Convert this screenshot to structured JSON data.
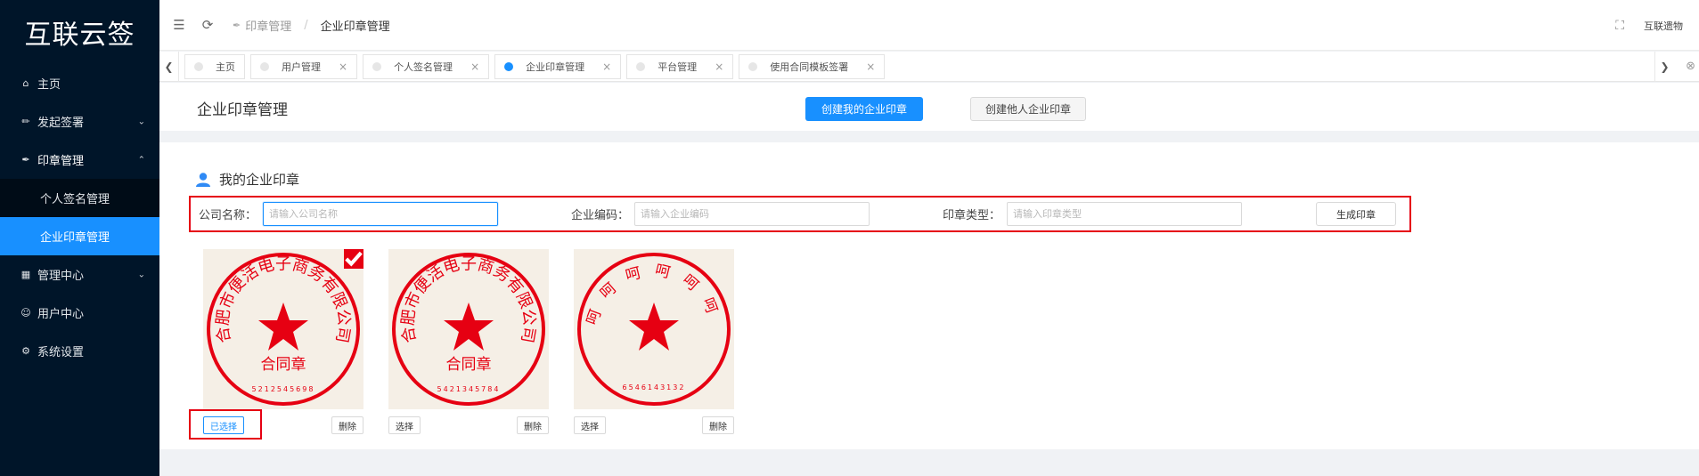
{
  "app": {
    "title": "互联云签"
  },
  "sidebar": {
    "items": [
      {
        "label": "主页",
        "icon": "home-icon"
      },
      {
        "label": "发起签署",
        "icon": "sign-icon"
      },
      {
        "label": "印章管理",
        "icon": "pen-icon"
      },
      {
        "label": "个人签名管理"
      },
      {
        "label": "企业印章管理"
      },
      {
        "label": "管理中心",
        "icon": "grid-icon"
      },
      {
        "label": "用户中心",
        "icon": "user-icon"
      },
      {
        "label": "系统设置",
        "icon": "gear-icon"
      }
    ]
  },
  "header": {
    "breadcrumb": [
      "印章管理",
      "企业印章管理"
    ],
    "separator": "/",
    "user": "互联遗物"
  },
  "tabs": [
    {
      "label": "主页"
    },
    {
      "label": "用户管理"
    },
    {
      "label": "个人签名管理"
    },
    {
      "label": "企业印章管理"
    },
    {
      "label": "平台管理"
    },
    {
      "label": "使用合同模板签署"
    }
  ],
  "page": {
    "title": "企业印章管理",
    "create_mine": "创建我的企业印章",
    "create_other": "创建他人企业印章"
  },
  "section": {
    "title": "我的企业印章"
  },
  "form": {
    "company_label": "公司名称：",
    "company_placeholder": "请输入公司名称",
    "code_label": "企业编码：",
    "code_placeholder": "请输入企业编码",
    "type_label": "印章类型：",
    "type_placeholder": "请输入印章类型",
    "generate": "生成印章"
  },
  "seals": [
    {
      "top_text": "合肥市便活电子商务有限公司",
      "bottom_text": "合同章",
      "code": "5212545698",
      "select_label": "已选择",
      "delete_label": "删除",
      "selected": true
    },
    {
      "top_text": "合肥市便活电子商务有限公司",
      "bottom_text": "合同章",
      "code": "5421345784",
      "select_label": "选择",
      "delete_label": "删除",
      "selected": false
    },
    {
      "top_text": "呵呵呵呵呵呵",
      "bottom_text": "",
      "code": "6546143132",
      "select_label": "选择",
      "delete_label": "删除",
      "selected": false
    }
  ],
  "colors": {
    "accent": "#1890ff",
    "sidebar": "#001529",
    "seal_red": "#e60012"
  }
}
